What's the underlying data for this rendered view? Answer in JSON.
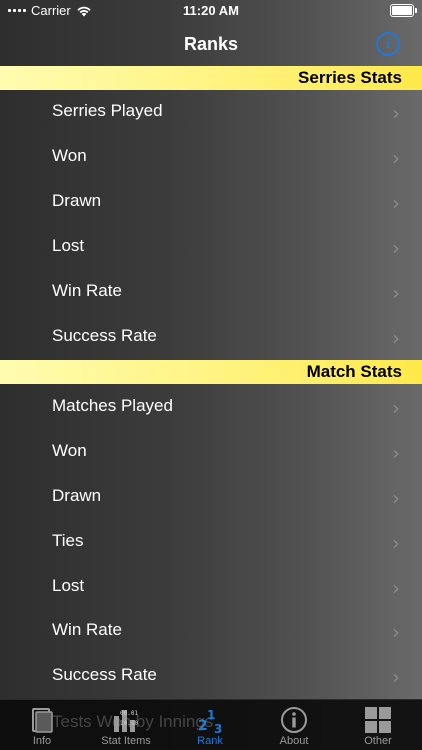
{
  "status_bar": {
    "carrier": "Carrier",
    "time": "11:20 AM"
  },
  "nav": {
    "title": "Ranks"
  },
  "sections": [
    {
      "header": "Serries Stats",
      "rows": [
        "Serries Played",
        "Won",
        "Drawn",
        "Lost",
        "Win Rate",
        "Success Rate"
      ]
    },
    {
      "header": "Match Stats",
      "rows": [
        "Matches Played",
        "Won",
        "Drawn",
        "Ties",
        "Lost",
        "Win Rate",
        "Success Rate"
      ]
    }
  ],
  "ghost_row": "Tests Won by Innings",
  "tabs": [
    {
      "label": "Info",
      "icon": "book-icon"
    },
    {
      "label": "Stat Items",
      "icon": "stat-items-icon"
    },
    {
      "label": "Rank",
      "icon": "rank-icon",
      "active": true
    },
    {
      "label": "About",
      "icon": "info-circle-icon"
    },
    {
      "label": "Other",
      "icon": "grid-icon"
    }
  ],
  "colors": {
    "accent": "#1e7ad8",
    "header_yellow": "#fff27a"
  }
}
